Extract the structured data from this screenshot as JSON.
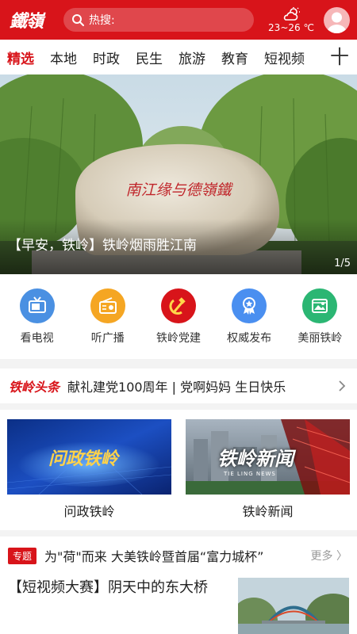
{
  "header": {
    "logo_text": "鐵嶺",
    "search_label": "热搜:",
    "weather_range": "23~26 ℃",
    "weather_icon": "partly-cloudy-icon",
    "avatar_icon": "user-avatar-icon",
    "brand_color": "#d8141a"
  },
  "tabs": {
    "items": [
      "精选",
      "本地",
      "时政",
      "民生",
      "旅游",
      "教育",
      "短视频"
    ],
    "active_index": 0,
    "add_icon": "plus-icon",
    "add_label": "十"
  },
  "banner": {
    "caption": "【早安，铁岭】铁岭烟雨胜江南",
    "counter": "1/5",
    "stone_inscription": "南江缘与德嶺鐵"
  },
  "quick_links": [
    {
      "label": "看电视",
      "icon": "tv-icon",
      "color": "#4a90e2"
    },
    {
      "label": "听广播",
      "icon": "radio-icon",
      "color": "#f5a623"
    },
    {
      "label": "铁岭党建",
      "icon": "party-emblem-icon",
      "color": "#d8141a"
    },
    {
      "label": "权威发布",
      "icon": "award-badge-icon",
      "color": "#4a8ff0"
    },
    {
      "label": "美丽铁岭",
      "icon": "landscape-icon",
      "color": "#2bb673"
    }
  ],
  "headline": {
    "tag": "铁岭头条",
    "text": "献礼建党100周年 | 党啊妈妈 生日快乐",
    "chevron_icon": "chevron-right-icon"
  },
  "video_cards": [
    {
      "label": "问政铁岭",
      "thumb_title": "问政铁岭"
    },
    {
      "label": "铁岭新闻",
      "thumb_title": "铁岭新闻",
      "thumb_subtitle": "TIE LING NEWS"
    }
  ],
  "topic": {
    "badge": "专题",
    "text": "为\"荷\"而来 大美铁岭暨首届“富力城杯”",
    "more": "更多 〉"
  },
  "article": {
    "title": "【短视频大赛】阴天中的东大桥"
  }
}
